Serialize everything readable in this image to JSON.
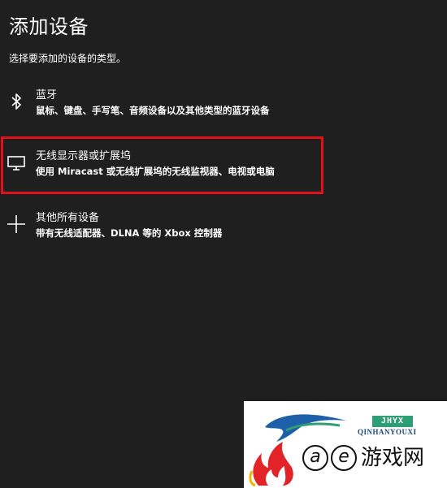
{
  "dialog": {
    "title": "添加设备",
    "subtitle": "选择要添加的设备的类型。"
  },
  "options": [
    {
      "icon": "bluetooth-icon",
      "label": "蓝牙",
      "description": "鼠标、键盘、手写笔、音频设备以及其他类型的蓝牙设备"
    },
    {
      "icon": "monitor-icon",
      "label": "无线显示器或扩展坞",
      "description": "使用 Miracast 或无线扩展坞的无线监视器、电视或电脑",
      "highlighted": true
    },
    {
      "icon": "plus-icon",
      "label": "其他所有设备",
      "description": "带有无线适配器、DLNA 等的 Xbox 控制器"
    }
  ],
  "watermark": {
    "brand": "JHYX",
    "pinyin": "QINHANYOUXI",
    "circle_a": "a",
    "circle_e": "e",
    "site_name": "游戏网"
  },
  "colors": {
    "background": "#1f1f1f",
    "text": "#ffffff",
    "highlight": "#e0111b"
  }
}
